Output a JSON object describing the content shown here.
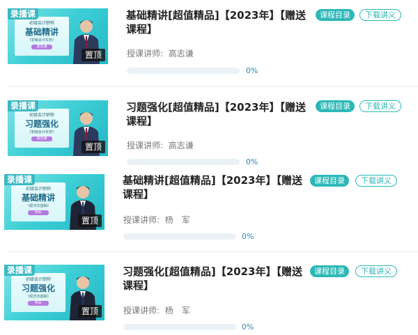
{
  "labels": {
    "recorded_tag": "录播课",
    "pin_tag": "置顶",
    "catalog_button": "课程目录",
    "download_button": "下载讲义",
    "teacher_prefix": "授课讲师:"
  },
  "colors": {
    "accent": "#2cb7b7",
    "percent_text": "#2b88b3"
  },
  "courses": [
    {
      "title": "基础精讲[超值精品]【2023年】【赠送课程】",
      "teacher": "高志谦",
      "progress": 0,
      "progress_text": "0%",
      "thumb": {
        "sub": "初级会计职称",
        "big": "基础精讲",
        "small": "《初级会计实务》",
        "pill": "高志谦"
      }
    },
    {
      "title": "习题强化[超值精品]【2023年】【赠送课程】",
      "teacher": "高志谦",
      "progress": 0,
      "progress_text": "0%",
      "thumb": {
        "sub": "初级会计职称",
        "big": "习题强化",
        "small": "《初级会计实务》",
        "pill": "高志谦"
      }
    },
    {
      "title": "基础精讲[超值精品]【2023年】【赠送课程】",
      "teacher": "杨　军",
      "progress": 0,
      "progress_text": "0%",
      "thumb": {
        "sub": "初级会计职称",
        "big": "基础精讲",
        "small": "《经济法基础》",
        "pill": "杨军"
      }
    },
    {
      "title": "习题强化[超值精品]【2023年】【赠送课程】",
      "teacher": "杨　军",
      "progress": 0,
      "progress_text": "0%",
      "thumb": {
        "sub": "初级会计职称",
        "big": "习题强化",
        "small": "《经济法基础》",
        "pill": "杨军"
      }
    }
  ]
}
